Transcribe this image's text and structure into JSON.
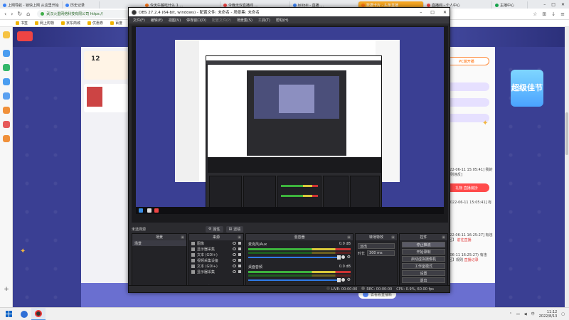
{
  "browser": {
    "tabs": [
      {
        "label": "上网导航 - 锁快上网 从这里开始",
        "fav": "b",
        "active": false
      },
      {
        "label": "历史记录",
        "fav": "b",
        "active": false
      },
      {
        "label": "今天午餐吃什么 1 …",
        "fav": "o",
        "active": false
      },
      {
        "label": "今晚无双直播间 …",
        "fav": "r",
        "active": false
      },
      {
        "label": "bilibili - 直播 …",
        "fav": "b",
        "active": false
      },
      {
        "label": "数据卡片 - 头条直播",
        "fav": "o",
        "active": true
      },
      {
        "label": "直播间 - 个人中心",
        "fav": "r",
        "active": false
      },
      {
        "label": "主播中心",
        "fav": "g",
        "active": false
      }
    ],
    "url": "武汉火墨网络科技有限公司 https://",
    "bookmarks": [
      "书签",
      "网上购物",
      "京东商城",
      "优惠券",
      "百度"
    ]
  },
  "page_right": {
    "btn_purple_1": "PC端开播",
    "btn_red": "礼物 直播装扮",
    "texts": [
      "20 [2022-06-11 15:05:41] 我的直播[规则违反]",
      "20 [2022-06-11 16:25:27] 有违【直播区】",
      "点击 [2022-06-11 15:05:41] 有违直播",
      "(2022-06-11 16:25:27) 有违【直播区】规则"
    ],
    "links": [
      "前往直播",
      "直播记录"
    ],
    "promo_label": "超级佳节",
    "bottom_btn": "去看看直播新"
  },
  "obs": {
    "title": "OBS 27.2.4 (64-bit, windows) - 配置文件: 未命名 - 场景集: 未命名",
    "menu": [
      "文件(F)",
      "编辑(E)",
      "视图(V)",
      "停靠窗口(D)",
      "配置文件(P)",
      "场景集(S)",
      "工具(T)",
      "帮助(H)"
    ],
    "scene_bar": {
      "label": "未选择源",
      "props": "属性",
      "filters": "滤镜"
    },
    "docks": {
      "scenes": {
        "title": "场景",
        "items": [
          "场景"
        ]
      },
      "sources": {
        "title": "来源",
        "items": [
          "图像",
          "显示器采集",
          "文本 (GDI+)",
          "视频采集设备",
          "文本 (GDI+)",
          "显示器采集"
        ]
      },
      "mixer": {
        "title": "混音器",
        "channels": [
          {
            "name": "麦克风/Aux",
            "db": "0.0 dB"
          },
          {
            "name": "桌面音频",
            "db": "0.0 dB"
          }
        ]
      },
      "transitions": {
        "title": "转场特效",
        "type": "淡出",
        "duration_label": "时长",
        "duration": "300 ms"
      },
      "controls": {
        "title": "控件",
        "buttons": [
          "停止推流",
          "开始录制",
          "启动虚拟摄像机",
          "工作室模式",
          "设置",
          "退出"
        ]
      }
    },
    "status": {
      "live": "LIVE: 00:00:00",
      "rec": "REC: 00:00:00",
      "cpu": "CPU: 0.9%, 60.00 fps"
    }
  },
  "taskbar": {
    "time": "11:12",
    "date": "2022/8/13"
  },
  "colors": {
    "page_bg": "#3a3f93",
    "obs_bg": "#2b2b2f",
    "accent_red": "#ff4b4b",
    "accent_purple": "#6a46d6"
  }
}
